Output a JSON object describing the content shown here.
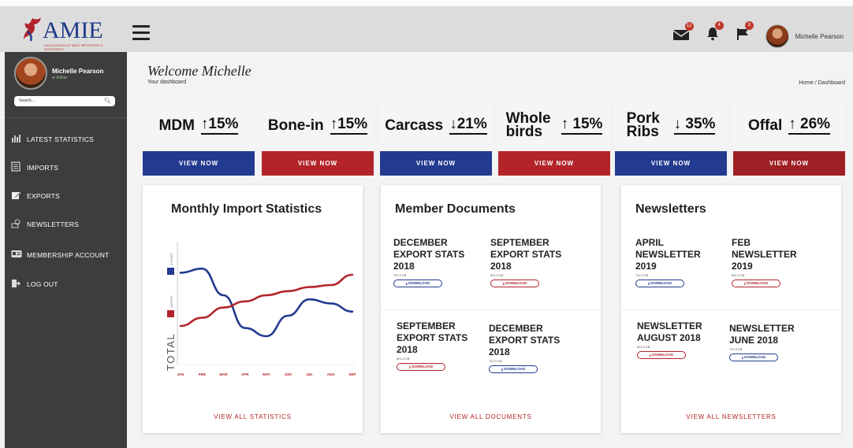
{
  "app": {
    "logo_text": "AMIE",
    "logo_sub": "ASSOCIATION OF MEAT IMPORTERS & EXPORTERS"
  },
  "topbar": {
    "user_name": "Michelle Pearson",
    "mail_count": "12",
    "bell_count": "4",
    "flag_count": "3"
  },
  "sidebar": {
    "user_name": "Michelle Pearson",
    "status": "● Online",
    "search_placeholder": "Search...",
    "items": [
      {
        "label": "LATEST STATISTICS",
        "icon": "bar-chart-icon"
      },
      {
        "label": "IMPORTS",
        "icon": "document-list-icon"
      },
      {
        "label": "EXPORTS",
        "icon": "edit-icon"
      },
      {
        "label": "NEWSLETTERS",
        "icon": "newsletter-icon"
      },
      {
        "label": "MEMBERSHIP ACCOUNT",
        "icon": "id-card-icon"
      },
      {
        "label": "LOG OUT",
        "icon": "logout-icon"
      }
    ]
  },
  "header": {
    "welcome": "Welcome Michelle",
    "subtitle": "Your dashboard",
    "breadcrumb": "Home / Dashboard"
  },
  "stats": [
    {
      "label": "MDM",
      "value": "↑15%",
      "button": "VIEW NOW"
    },
    {
      "label": "Bone-in",
      "value": "↑15%",
      "button": "VIEW NOW"
    },
    {
      "label": "Carcass",
      "value": "↓21%",
      "button": "VIEW NOW"
    },
    {
      "label": "Whole birds",
      "value": "↑ 15%",
      "button": "VIEW NOW"
    },
    {
      "label": "Pork Ribs",
      "value": "↓ 35%",
      "button": "VIEW NOW"
    },
    {
      "label": "Offal",
      "value": "↑ 26%",
      "button": "VIEW NOW"
    }
  ],
  "chart_card": {
    "title": "Monthly Import Statistics",
    "footer": "VIEW ALL STATISTICS"
  },
  "chart_data": {
    "type": "line",
    "categories": [
      "JAN",
      "FEB",
      "MAR",
      "APR",
      "MAY",
      "JUN",
      "JUL",
      "AUG",
      "SEP"
    ],
    "ylabel": "TOTAL",
    "legend": [
      {
        "name": "EXPORT",
        "color": "#223a8f"
      },
      {
        "name": "IMPORT",
        "color": "#b2242a"
      }
    ],
    "series": [
      {
        "name": "EXPORT",
        "color": "#223a8f",
        "values": [
          82,
          86,
          60,
          28,
          20,
          40,
          56,
          52,
          44
        ]
      },
      {
        "name": "IMPORT",
        "color": "#b2242a",
        "values": [
          30,
          38,
          48,
          54,
          60,
          64,
          68,
          70,
          80
        ]
      }
    ],
    "ylim": [
      0,
      100
    ],
    "grid": false
  },
  "documents": {
    "title": "Member Documents",
    "footer": "VIEW ALL DOCUMENTS",
    "items": [
      {
        "title": "DECEMBER EXPORT STATS 2018",
        "size": "742.0 KB",
        "button": "DOWNLOAD",
        "style": "b"
      },
      {
        "title": "SEPTEMBER EXPORT STATS 2018",
        "size": "891.0 KB",
        "button": "DOWNLOAD",
        "style": "r"
      },
      {
        "title": "SEPTEMBER EXPORT STATS 2018",
        "size": "891.0 KB",
        "button": "DOWNLOAD",
        "style": "r"
      },
      {
        "title": "DECEMBER EXPORT STATS 2018",
        "size": "742.0 KB",
        "button": "DOWNLOAD",
        "style": "b"
      }
    ]
  },
  "newsletters": {
    "title": "Newsletters",
    "footer": "VIEW ALL NEWSLETTERS",
    "items": [
      {
        "title": "APRIL NEWSLETTER 2019",
        "size": "742.0 KB",
        "button": "DOWNLOAD",
        "style": "b"
      },
      {
        "title": "FEB NEWSLETTER 2019",
        "size": "891.0 KB",
        "button": "DOWNLOAD",
        "style": "r"
      },
      {
        "title": "NEWSLETTER AUGUST 2018",
        "size": "891.0 KB",
        "button": "DOWNLOAD",
        "style": "r"
      },
      {
        "title": "NEWSLETTER JUNE 2018",
        "size": "742.0 KB",
        "button": "DOWNLOAD",
        "style": "b"
      }
    ]
  }
}
